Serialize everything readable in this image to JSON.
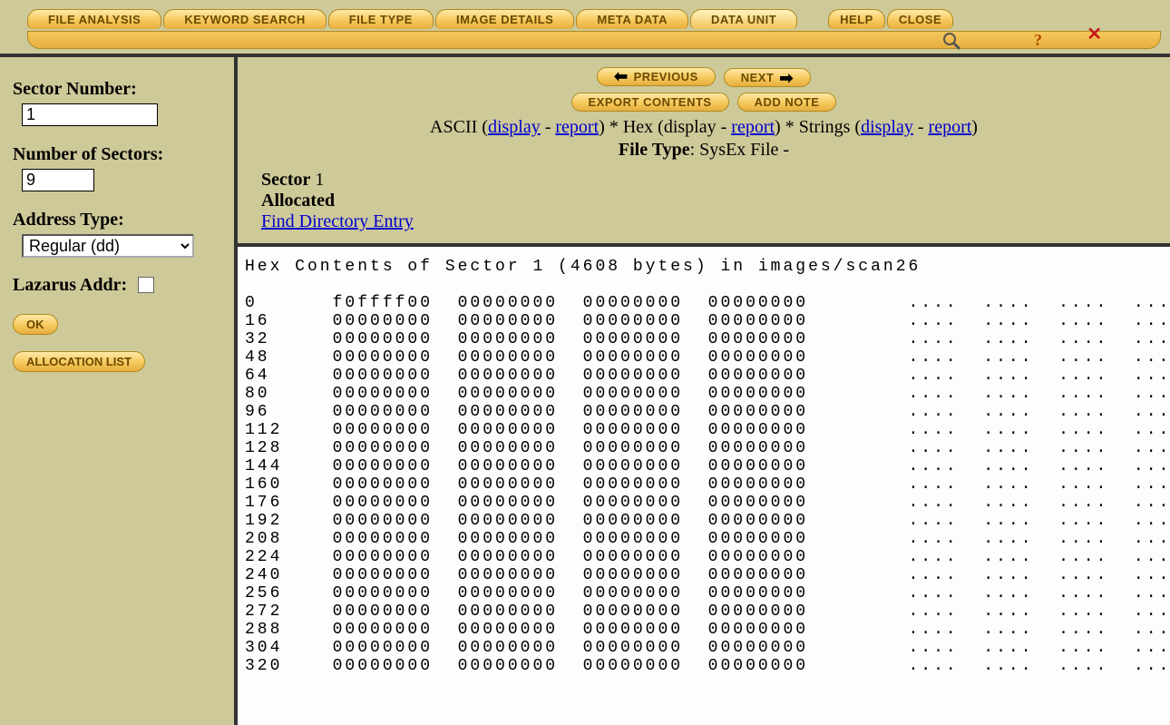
{
  "toolbar": {
    "tabs": [
      {
        "id": "file-analysis",
        "label": "FILE ANALYSIS"
      },
      {
        "id": "keyword-search",
        "label": "KEYWORD SEARCH"
      },
      {
        "id": "file-type",
        "label": "FILE TYPE"
      },
      {
        "id": "image-details",
        "label": "IMAGE DETAILS"
      },
      {
        "id": "meta-data",
        "label": "META DATA"
      },
      {
        "id": "data-unit",
        "label": "DATA UNIT"
      }
    ],
    "help_label": "HELP",
    "close_label": "CLOSE"
  },
  "sidebar": {
    "sector_number_label": "Sector Number:",
    "sector_number_value": "1",
    "num_sectors_label": "Number of Sectors:",
    "num_sectors_value": "9",
    "address_type_label": "Address Type:",
    "address_type_value": "Regular (dd)",
    "lazarus_label": "Lazarus Addr:",
    "lazarus_checked": false,
    "ok_label": "OK",
    "alloc_list_label": "ALLOCATION LIST"
  },
  "header": {
    "prev_label": "PREVIOUS",
    "next_label": "NEXT",
    "export_label": "EXPORT CONTENTS",
    "addnote_label": "ADD NOTE",
    "fmt": {
      "ascii": "ASCII",
      "hex": "Hex",
      "strings": "Strings",
      "display": "display",
      "report": "report"
    },
    "file_type_label": "File Type",
    "file_type_value": "SysEx File -",
    "sector_label": "Sector",
    "sector_value": "1",
    "alloc_label": "Allocated",
    "find_dir_entry": "Find Directory Entry"
  },
  "hex": {
    "title": "Hex Contents of Sector 1 (4608 bytes) in images/scan26",
    "row_bytes": 16,
    "rows": [
      {
        "off": 0,
        "h": [
          "f0ffff00",
          "00000000",
          "00000000",
          "00000000"
        ],
        "a": "....  ....  ....  ...."
      },
      {
        "off": 16,
        "h": [
          "00000000",
          "00000000",
          "00000000",
          "00000000"
        ],
        "a": "....  ....  ....  ...."
      },
      {
        "off": 32,
        "h": [
          "00000000",
          "00000000",
          "00000000",
          "00000000"
        ],
        "a": "....  ....  ....  ...."
      },
      {
        "off": 48,
        "h": [
          "00000000",
          "00000000",
          "00000000",
          "00000000"
        ],
        "a": "....  ....  ....  ...."
      },
      {
        "off": 64,
        "h": [
          "00000000",
          "00000000",
          "00000000",
          "00000000"
        ],
        "a": "....  ....  ....  ...."
      },
      {
        "off": 80,
        "h": [
          "00000000",
          "00000000",
          "00000000",
          "00000000"
        ],
        "a": "....  ....  ....  ...."
      },
      {
        "off": 96,
        "h": [
          "00000000",
          "00000000",
          "00000000",
          "00000000"
        ],
        "a": "....  ....  ....  ...."
      },
      {
        "off": 112,
        "h": [
          "00000000",
          "00000000",
          "00000000",
          "00000000"
        ],
        "a": "....  ....  ....  ...."
      },
      {
        "off": 128,
        "h": [
          "00000000",
          "00000000",
          "00000000",
          "00000000"
        ],
        "a": "....  ....  ....  ...."
      },
      {
        "off": 144,
        "h": [
          "00000000",
          "00000000",
          "00000000",
          "00000000"
        ],
        "a": "....  ....  ....  ...."
      },
      {
        "off": 160,
        "h": [
          "00000000",
          "00000000",
          "00000000",
          "00000000"
        ],
        "a": "....  ....  ....  ...."
      },
      {
        "off": 176,
        "h": [
          "00000000",
          "00000000",
          "00000000",
          "00000000"
        ],
        "a": "....  ....  ....  ...."
      },
      {
        "off": 192,
        "h": [
          "00000000",
          "00000000",
          "00000000",
          "00000000"
        ],
        "a": "....  ....  ....  ...."
      },
      {
        "off": 208,
        "h": [
          "00000000",
          "00000000",
          "00000000",
          "00000000"
        ],
        "a": "....  ....  ....  ...."
      },
      {
        "off": 224,
        "h": [
          "00000000",
          "00000000",
          "00000000",
          "00000000"
        ],
        "a": "....  ....  ....  ...."
      },
      {
        "off": 240,
        "h": [
          "00000000",
          "00000000",
          "00000000",
          "00000000"
        ],
        "a": "....  ....  ....  ...."
      },
      {
        "off": 256,
        "h": [
          "00000000",
          "00000000",
          "00000000",
          "00000000"
        ],
        "a": "....  ....  ....  ...."
      },
      {
        "off": 272,
        "h": [
          "00000000",
          "00000000",
          "00000000",
          "00000000"
        ],
        "a": "....  ....  ....  ...."
      },
      {
        "off": 288,
        "h": [
          "00000000",
          "00000000",
          "00000000",
          "00000000"
        ],
        "a": "....  ....  ....  ...."
      },
      {
        "off": 304,
        "h": [
          "00000000",
          "00000000",
          "00000000",
          "00000000"
        ],
        "a": "....  ....  ....  ...."
      },
      {
        "off": 320,
        "h": [
          "00000000",
          "00000000",
          "00000000",
          "00000000"
        ],
        "a": "....  ....  ....  ...."
      }
    ]
  }
}
